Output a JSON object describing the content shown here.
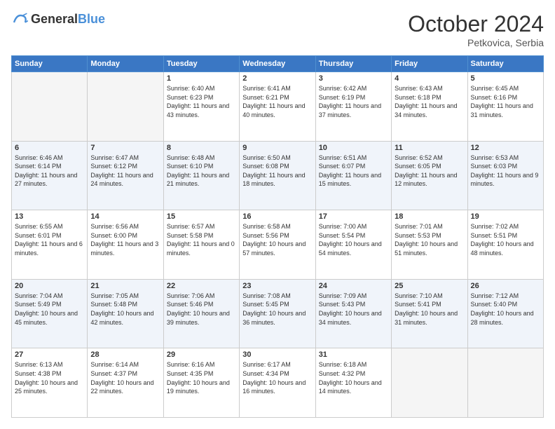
{
  "header": {
    "logo_line1": "General",
    "logo_line2": "Blue",
    "month": "October 2024",
    "location": "Petkovica, Serbia"
  },
  "weekdays": [
    "Sunday",
    "Monday",
    "Tuesday",
    "Wednesday",
    "Thursday",
    "Friday",
    "Saturday"
  ],
  "weeks": [
    [
      {
        "day": "",
        "info": ""
      },
      {
        "day": "",
        "info": ""
      },
      {
        "day": "1",
        "info": "Sunrise: 6:40 AM\nSunset: 6:23 PM\nDaylight: 11 hours and 43 minutes."
      },
      {
        "day": "2",
        "info": "Sunrise: 6:41 AM\nSunset: 6:21 PM\nDaylight: 11 hours and 40 minutes."
      },
      {
        "day": "3",
        "info": "Sunrise: 6:42 AM\nSunset: 6:19 PM\nDaylight: 11 hours and 37 minutes."
      },
      {
        "day": "4",
        "info": "Sunrise: 6:43 AM\nSunset: 6:18 PM\nDaylight: 11 hours and 34 minutes."
      },
      {
        "day": "5",
        "info": "Sunrise: 6:45 AM\nSunset: 6:16 PM\nDaylight: 11 hours and 31 minutes."
      }
    ],
    [
      {
        "day": "6",
        "info": "Sunrise: 6:46 AM\nSunset: 6:14 PM\nDaylight: 11 hours and 27 minutes."
      },
      {
        "day": "7",
        "info": "Sunrise: 6:47 AM\nSunset: 6:12 PM\nDaylight: 11 hours and 24 minutes."
      },
      {
        "day": "8",
        "info": "Sunrise: 6:48 AM\nSunset: 6:10 PM\nDaylight: 11 hours and 21 minutes."
      },
      {
        "day": "9",
        "info": "Sunrise: 6:50 AM\nSunset: 6:08 PM\nDaylight: 11 hours and 18 minutes."
      },
      {
        "day": "10",
        "info": "Sunrise: 6:51 AM\nSunset: 6:07 PM\nDaylight: 11 hours and 15 minutes."
      },
      {
        "day": "11",
        "info": "Sunrise: 6:52 AM\nSunset: 6:05 PM\nDaylight: 11 hours and 12 minutes."
      },
      {
        "day": "12",
        "info": "Sunrise: 6:53 AM\nSunset: 6:03 PM\nDaylight: 11 hours and 9 minutes."
      }
    ],
    [
      {
        "day": "13",
        "info": "Sunrise: 6:55 AM\nSunset: 6:01 PM\nDaylight: 11 hours and 6 minutes."
      },
      {
        "day": "14",
        "info": "Sunrise: 6:56 AM\nSunset: 6:00 PM\nDaylight: 11 hours and 3 minutes."
      },
      {
        "day": "15",
        "info": "Sunrise: 6:57 AM\nSunset: 5:58 PM\nDaylight: 11 hours and 0 minutes."
      },
      {
        "day": "16",
        "info": "Sunrise: 6:58 AM\nSunset: 5:56 PM\nDaylight: 10 hours and 57 minutes."
      },
      {
        "day": "17",
        "info": "Sunrise: 7:00 AM\nSunset: 5:54 PM\nDaylight: 10 hours and 54 minutes."
      },
      {
        "day": "18",
        "info": "Sunrise: 7:01 AM\nSunset: 5:53 PM\nDaylight: 10 hours and 51 minutes."
      },
      {
        "day": "19",
        "info": "Sunrise: 7:02 AM\nSunset: 5:51 PM\nDaylight: 10 hours and 48 minutes."
      }
    ],
    [
      {
        "day": "20",
        "info": "Sunrise: 7:04 AM\nSunset: 5:49 PM\nDaylight: 10 hours and 45 minutes."
      },
      {
        "day": "21",
        "info": "Sunrise: 7:05 AM\nSunset: 5:48 PM\nDaylight: 10 hours and 42 minutes."
      },
      {
        "day": "22",
        "info": "Sunrise: 7:06 AM\nSunset: 5:46 PM\nDaylight: 10 hours and 39 minutes."
      },
      {
        "day": "23",
        "info": "Sunrise: 7:08 AM\nSunset: 5:45 PM\nDaylight: 10 hours and 36 minutes."
      },
      {
        "day": "24",
        "info": "Sunrise: 7:09 AM\nSunset: 5:43 PM\nDaylight: 10 hours and 34 minutes."
      },
      {
        "day": "25",
        "info": "Sunrise: 7:10 AM\nSunset: 5:41 PM\nDaylight: 10 hours and 31 minutes."
      },
      {
        "day": "26",
        "info": "Sunrise: 7:12 AM\nSunset: 5:40 PM\nDaylight: 10 hours and 28 minutes."
      }
    ],
    [
      {
        "day": "27",
        "info": "Sunrise: 6:13 AM\nSunset: 4:38 PM\nDaylight: 10 hours and 25 minutes."
      },
      {
        "day": "28",
        "info": "Sunrise: 6:14 AM\nSunset: 4:37 PM\nDaylight: 10 hours and 22 minutes."
      },
      {
        "day": "29",
        "info": "Sunrise: 6:16 AM\nSunset: 4:35 PM\nDaylight: 10 hours and 19 minutes."
      },
      {
        "day": "30",
        "info": "Sunrise: 6:17 AM\nSunset: 4:34 PM\nDaylight: 10 hours and 16 minutes."
      },
      {
        "day": "31",
        "info": "Sunrise: 6:18 AM\nSunset: 4:32 PM\nDaylight: 10 hours and 14 minutes."
      },
      {
        "day": "",
        "info": ""
      },
      {
        "day": "",
        "info": ""
      }
    ]
  ]
}
